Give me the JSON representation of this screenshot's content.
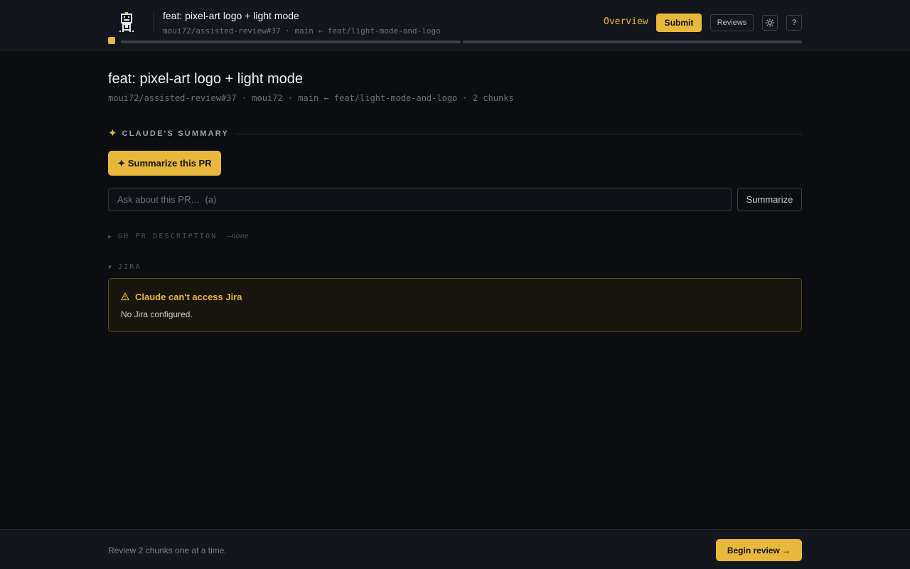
{
  "header": {
    "logo_icon": "robot-pixel-icon",
    "title": "feat: pixel-art logo + light mode",
    "subtitle": "moui72/assisted-review#37 · main ← feat/light-mode-and-logo",
    "nav_overview": "Overview",
    "submit_label": "Submit",
    "reviews_label": "Reviews",
    "theme_icon": "sun-icon",
    "help_label": "?"
  },
  "page": {
    "title": "feat: pixel-art logo + light mode",
    "meta": "moui72/assisted-review#37 · moui72 · main ← feat/light-mode-and-logo · 2 chunks"
  },
  "summary": {
    "icon": "sparkle-icon",
    "section_label": "CLAUDE'S SUMMARY",
    "summarize_pr_label": "✦ Summarize this PR",
    "ask_placeholder": "Ask about this PR…  (a)",
    "ask_value": "",
    "summarize_label": "Summarize"
  },
  "gh_description": {
    "label": "GH PR DESCRIPTION",
    "value": "—none",
    "expanded": false
  },
  "jira": {
    "label": "JIRA",
    "expanded": true,
    "alert_icon": "warning-triangle-icon",
    "alert_title": "Claude can't access Jira",
    "alert_body": "No Jira configured."
  },
  "footer": {
    "text": "Review 2 chunks one at a time.",
    "begin_label": "Begin review →"
  },
  "colors": {
    "accent": "#e8b83c",
    "background": "#0b0d11",
    "panel": "#13161d",
    "alert_border": "#5a4a1e"
  }
}
